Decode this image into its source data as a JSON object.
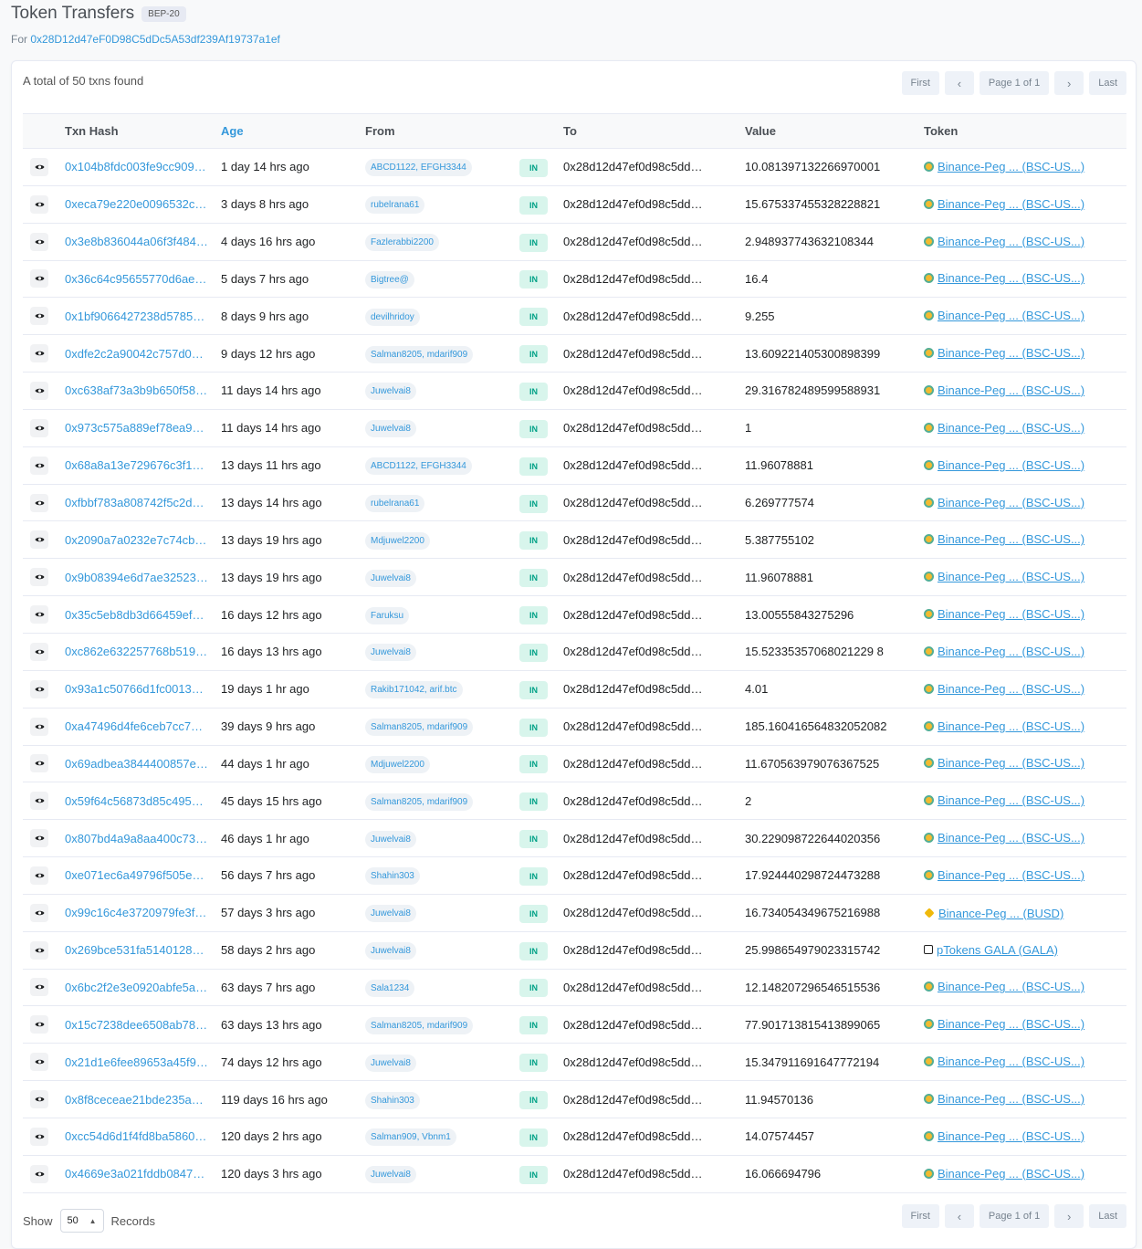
{
  "header": {
    "title": "Token Transfers",
    "badge": "BEP-20",
    "for_label": "For",
    "address": "0x28D12d47eF0D98C5dDc5A53df239Af19737a1ef"
  },
  "summary": {
    "total_text": "A total of 50 txns found"
  },
  "pagination": {
    "first": "First",
    "prev": "‹",
    "page_info": "Page 1 of 1",
    "next": "›",
    "last": "Last"
  },
  "table": {
    "headers": {
      "hash": "Txn Hash",
      "age": "Age",
      "from": "From",
      "to": "To",
      "value": "Value",
      "token": "Token"
    },
    "rows": [
      {
        "hash": "0x104b8fdc003fe9cc909…",
        "age": "1 day 14 hrs ago",
        "from": "ABCD1122, EFGH3344",
        "dir": "IN",
        "to": "0x28d12d47ef0d98c5dd…",
        "value": "10.081397132266970001",
        "token": "Binance-Peg ... (BSC-US...)",
        "icon": "usdt-icon"
      },
      {
        "hash": "0xeca79e220e0096532c…",
        "age": "3 days 8 hrs ago",
        "from": "rubelrana61",
        "dir": "IN",
        "to": "0x28d12d47ef0d98c5dd…",
        "value": "15.675337455328228821",
        "token": "Binance-Peg ... (BSC-US...)",
        "icon": "usdt-icon"
      },
      {
        "hash": "0x3e8b836044a06f3f484…",
        "age": "4 days 16 hrs ago",
        "from": "Fazlerabbi2200",
        "dir": "IN",
        "to": "0x28d12d47ef0d98c5dd…",
        "value": "2.948937743632108344",
        "token": "Binance-Peg ... (BSC-US...)",
        "icon": "usdt-icon"
      },
      {
        "hash": "0x36c64c95655770d6ae…",
        "age": "5 days 7 hrs ago",
        "from": "Bigtree@",
        "dir": "IN",
        "to": "0x28d12d47ef0d98c5dd…",
        "value": "16.4",
        "token": "Binance-Peg ... (BSC-US...)",
        "icon": "usdt-icon"
      },
      {
        "hash": "0x1bf9066427238d5785…",
        "age": "8 days 9 hrs ago",
        "from": "devilhridoy",
        "dir": "IN",
        "to": "0x28d12d47ef0d98c5dd…",
        "value": "9.255",
        "token": "Binance-Peg ... (BSC-US...)",
        "icon": "usdt-icon"
      },
      {
        "hash": "0xdfe2c2a90042c757d0…",
        "age": "9 days 12 hrs ago",
        "from": "Salman8205, mdarif909",
        "dir": "IN",
        "to": "0x28d12d47ef0d98c5dd…",
        "value": "13.609221405300898399",
        "token": "Binance-Peg ... (BSC-US...)",
        "icon": "usdt-icon"
      },
      {
        "hash": "0xc638af73a3b9b650f58…",
        "age": "11 days 14 hrs ago",
        "from": "Juwelvai8",
        "dir": "IN",
        "to": "0x28d12d47ef0d98c5dd…",
        "value": "29.316782489599588931",
        "token": "Binance-Peg ... (BSC-US...)",
        "icon": "usdt-icon"
      },
      {
        "hash": "0x973c575a889ef78ea9…",
        "age": "11 days 14 hrs ago",
        "from": "Juwelvai8",
        "dir": "IN",
        "to": "0x28d12d47ef0d98c5dd…",
        "value": "1",
        "token": "Binance-Peg ... (BSC-US...)",
        "icon": "usdt-icon"
      },
      {
        "hash": "0x68a8a13e729676c3f1…",
        "age": "13 days 11 hrs ago",
        "from": "ABCD1122, EFGH3344",
        "dir": "IN",
        "to": "0x28d12d47ef0d98c5dd…",
        "value": "11.96078881",
        "token": "Binance-Peg ... (BSC-US...)",
        "icon": "usdt-icon"
      },
      {
        "hash": "0xfbbf783a808742f5c2d…",
        "age": "13 days 14 hrs ago",
        "from": "rubelrana61",
        "dir": "IN",
        "to": "0x28d12d47ef0d98c5dd…",
        "value": "6.269777574",
        "token": "Binance-Peg ... (BSC-US...)",
        "icon": "usdt-icon"
      },
      {
        "hash": "0x2090a7a0232e7c74cb…",
        "age": "13 days 19 hrs ago",
        "from": "Mdjuwel2200",
        "dir": "IN",
        "to": "0x28d12d47ef0d98c5dd…",
        "value": "5.387755102",
        "token": "Binance-Peg ... (BSC-US...)",
        "icon": "usdt-icon"
      },
      {
        "hash": "0x9b08394e6d7ae32523…",
        "age": "13 days 19 hrs ago",
        "from": "Juwelvai8",
        "dir": "IN",
        "to": "0x28d12d47ef0d98c5dd…",
        "value": "11.96078881",
        "token": "Binance-Peg ... (BSC-US...)",
        "icon": "usdt-icon"
      },
      {
        "hash": "0x35c5eb8db3d66459ef…",
        "age": "16 days 12 hrs ago",
        "from": "Faruksu",
        "dir": "IN",
        "to": "0x28d12d47ef0d98c5dd…",
        "value": "13.00555843275296",
        "token": "Binance-Peg ... (BSC-US...)",
        "icon": "usdt-icon"
      },
      {
        "hash": "0xc862e632257768b519…",
        "age": "16 days 13 hrs ago",
        "from": "Juwelvai8",
        "dir": "IN",
        "to": "0x28d12d47ef0d98c5dd…",
        "value": "15.52335357068021229 8",
        "token": "Binance-Peg ... (BSC-US...)",
        "icon": "usdt-icon"
      },
      {
        "hash": "0x93a1c50766d1fc0013…",
        "age": "19 days 1 hr ago",
        "from": "Rakib171042, arif.btc",
        "dir": "IN",
        "to": "0x28d12d47ef0d98c5dd…",
        "value": "4.01",
        "token": "Binance-Peg ... (BSC-US...)",
        "icon": "usdt-icon"
      },
      {
        "hash": "0xa47496d4fe6ceb7cc7…",
        "age": "39 days 9 hrs ago",
        "from": "Salman8205, mdarif909",
        "dir": "IN",
        "to": "0x28d12d47ef0d98c5dd…",
        "value": "185.160416564832052082",
        "token": "Binance-Peg ... (BSC-US...)",
        "icon": "usdt-icon"
      },
      {
        "hash": "0x69adbea3844400857e…",
        "age": "44 days 1 hr ago",
        "from": "Mdjuwel2200",
        "dir": "IN",
        "to": "0x28d12d47ef0d98c5dd…",
        "value": "11.670563979076367525",
        "token": "Binance-Peg ... (BSC-US...)",
        "icon": "usdt-icon"
      },
      {
        "hash": "0x59f64c56873d85c495…",
        "age": "45 days 15 hrs ago",
        "from": "Salman8205, mdarif909",
        "dir": "IN",
        "to": "0x28d12d47ef0d98c5dd…",
        "value": "2",
        "token": "Binance-Peg ... (BSC-US...)",
        "icon": "usdt-icon"
      },
      {
        "hash": "0x807bd4a9a8aa400c73…",
        "age": "46 days 1 hr ago",
        "from": "Juwelvai8",
        "dir": "IN",
        "to": "0x28d12d47ef0d98c5dd…",
        "value": "30.229098722644020356",
        "token": "Binance-Peg ... (BSC-US...)",
        "icon": "usdt-icon"
      },
      {
        "hash": "0xe071ec6a49796f505e…",
        "age": "56 days 7 hrs ago",
        "from": "Shahin303",
        "dir": "IN",
        "to": "0x28d12d47ef0d98c5dd…",
        "value": "17.924440298724473288",
        "token": "Binance-Peg ... (BSC-US...)",
        "icon": "usdt-icon"
      },
      {
        "hash": "0x99c16c4e3720979fe3f…",
        "age": "57 days 3 hrs ago",
        "from": "Juwelvai8",
        "dir": "IN",
        "to": "0x28d12d47ef0d98c5dd…",
        "value": "16.734054349675216988",
        "token": "Binance-Peg ... (BUSD)",
        "icon": "busd-icon"
      },
      {
        "hash": "0x269bce531fa5140128…",
        "age": "58 days 2 hrs ago",
        "from": "Juwelvai8",
        "dir": "IN",
        "to": "0x28d12d47ef0d98c5dd…",
        "value": "25.998654979023315742",
        "token": "pTokens GALA (GALA)",
        "icon": "gala-icon"
      },
      {
        "hash": "0x6bc2f2e3e0920abfe5a…",
        "age": "63 days 7 hrs ago",
        "from": "Sala1234",
        "dir": "IN",
        "to": "0x28d12d47ef0d98c5dd…",
        "value": "12.148207296546515536",
        "token": "Binance-Peg ... (BSC-US...)",
        "icon": "usdt-icon"
      },
      {
        "hash": "0x15c7238dee6508ab78…",
        "age": "63 days 13 hrs ago",
        "from": "Salman8205, mdarif909",
        "dir": "IN",
        "to": "0x28d12d47ef0d98c5dd…",
        "value": "77.901713815413899065",
        "token": "Binance-Peg ... (BSC-US...)",
        "icon": "usdt-icon"
      },
      {
        "hash": "0x21d1e6fee89653a45f9…",
        "age": "74 days 12 hrs ago",
        "from": "Juwelvai8",
        "dir": "IN",
        "to": "0x28d12d47ef0d98c5dd…",
        "value": "15.347911691647772194",
        "token": "Binance-Peg ... (BSC-US...)",
        "icon": "usdt-icon"
      },
      {
        "hash": "0x8f8ceceae21bde235a…",
        "age": "119 days 16 hrs ago",
        "from": "Shahin303",
        "dir": "IN",
        "to": "0x28d12d47ef0d98c5dd…",
        "value": "11.94570136",
        "token": "Binance-Peg ... (BSC-US...)",
        "icon": "usdt-icon"
      },
      {
        "hash": "0xcc54d6d1f4fd8ba5860…",
        "age": "120 days 2 hrs ago",
        "from": "Salman909, Vbnm1",
        "dir": "IN",
        "to": "0x28d12d47ef0d98c5dd…",
        "value": "14.07574457",
        "token": "Binance-Peg ... (BSC-US...)",
        "icon": "usdt-icon"
      },
      {
        "hash": "0x4669e3a021fddb0847…",
        "age": "120 days 3 hrs ago",
        "from": "Juwelvai8",
        "dir": "IN",
        "to": "0x28d12d47ef0d98c5dd…",
        "value": "16.066694796",
        "token": "Binance-Peg ... (BSC-US...)",
        "icon": "usdt-icon"
      }
    ]
  },
  "footer": {
    "show_label": "Show",
    "page_size": "50",
    "records_label": "Records"
  },
  "colors": {
    "link": "#3498db",
    "in_badge_bg": "#d8f5ec",
    "in_badge_text": "#00a186",
    "border": "#e7eaf3"
  }
}
